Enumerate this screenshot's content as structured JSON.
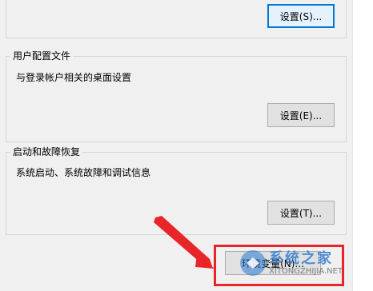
{
  "top_group": {
    "button_label": "设置(S)..."
  },
  "user_profiles": {
    "title": "用户配置文件",
    "description": "与登录帐户相关的桌面设置",
    "button_label": "设置(E)..."
  },
  "startup_recovery": {
    "title": "启动和故障恢复",
    "description": "系统启动、系统故障和调试信息",
    "button_label": "设置(T)..."
  },
  "env_button_label": "环境变量(N)...",
  "watermark": {
    "title": "系统之家",
    "url": "XITONGZHIJIA.NET"
  },
  "colors": {
    "highlight_box": "#e8262a",
    "focus_border": "#0078d7"
  }
}
